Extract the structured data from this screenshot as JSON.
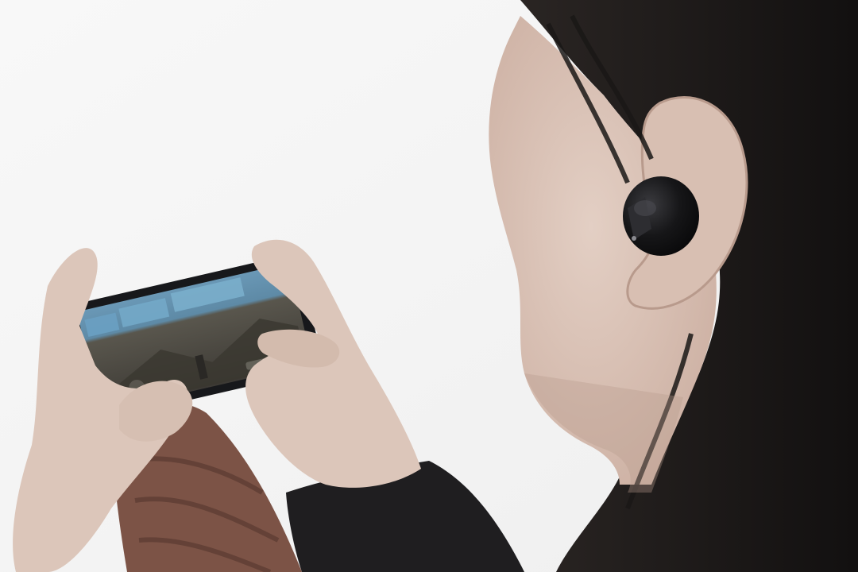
{
  "photo": {
    "subject": "person",
    "objects": [
      "smartphone",
      "earbud"
    ],
    "palette": {
      "background": "#f6f6f6",
      "skin": "#d9c2b6",
      "skin_shadow": "#b89a8c",
      "hair": "#1d1a19",
      "sleeve": "#1f1e20",
      "sweater": "#7c5346",
      "phone_body": "#17181b",
      "screen_sky": "#5c8aa8",
      "screen_ground": "#4f4a43",
      "earbud": "#121214"
    }
  }
}
